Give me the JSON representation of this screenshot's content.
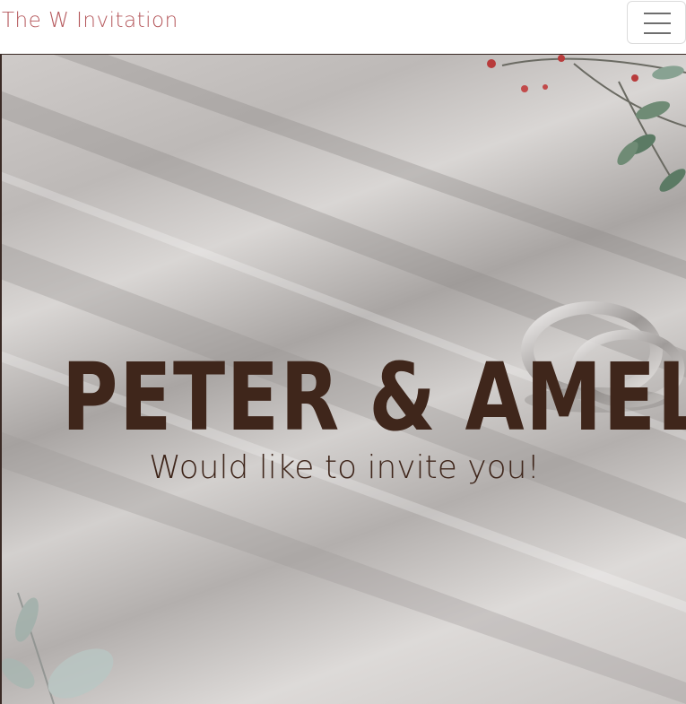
{
  "navbar": {
    "brand": "The W Invitation",
    "toggle_icon": "hamburger-menu-icon"
  },
  "hero": {
    "title": "PETER & AMELIA",
    "subtitle": "Would like to invite you!",
    "background": "wedding-rings-on-wood-photo",
    "decor": [
      "leaf-branch-top-right",
      "leaf-branch-bottom-left"
    ]
  },
  "colors": {
    "brand_text": "#b5585c",
    "title_text": "#3f261b",
    "toggle_bars": "#6e6e6e"
  }
}
